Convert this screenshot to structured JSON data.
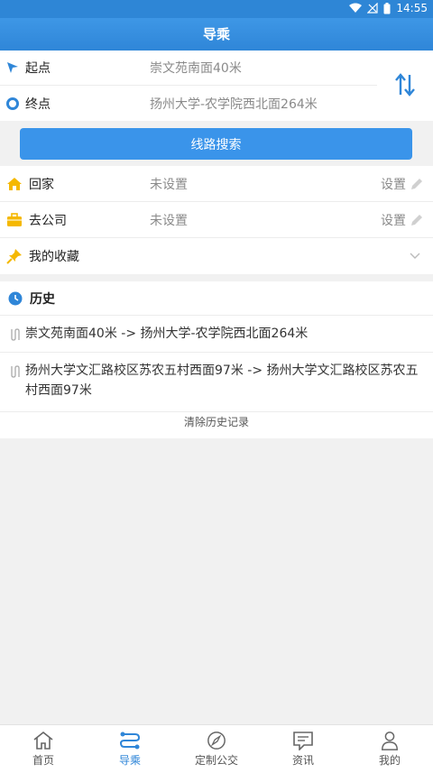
{
  "status": {
    "time": "14:55"
  },
  "appbar": {
    "title": "导乘"
  },
  "route": {
    "start_label": "起点",
    "start_value": "崇文苑南面40米",
    "end_label": "终点",
    "end_value": "扬州大学-农学院西北面264米"
  },
  "search": {
    "button_label": "线路搜索"
  },
  "places": {
    "home_label": "回家",
    "home_value": "未设置",
    "home_set": "设置",
    "company_label": "去公司",
    "company_value": "未设置",
    "company_set": "设置",
    "favorites_label": "我的收藏"
  },
  "history": {
    "title": "历史",
    "items": [
      "崇文苑南面40米 -> 扬州大学-农学院西北面264米",
      "扬州大学文汇路校区苏农五村西面97米 -> 扬州大学文汇路校区苏农五村西面97米"
    ],
    "clear_label": "清除历史记录"
  },
  "tabs": [
    {
      "label": "首页",
      "icon": "home-icon"
    },
    {
      "label": "导乘",
      "icon": "route-icon"
    },
    {
      "label": "定制公交",
      "icon": "compass-icon"
    },
    {
      "label": "资讯",
      "icon": "message-icon"
    },
    {
      "label": "我的",
      "icon": "user-icon"
    }
  ],
  "colors": {
    "primary": "#2f86d8",
    "button": "#3a94ea",
    "background": "#f1f1f1"
  }
}
